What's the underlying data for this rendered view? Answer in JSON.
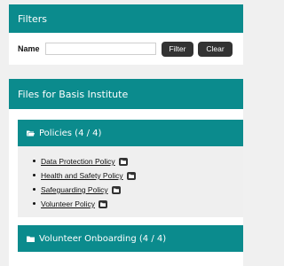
{
  "filters": {
    "title": "Filters",
    "name_label": "Name",
    "name_value": "",
    "filter_button": "Filter",
    "clear_button": "Clear"
  },
  "files": {
    "title": "Files for Basis Institute",
    "sections": [
      {
        "title": "Policies (4 / 4)",
        "icon": "folder-open-icon",
        "items": [
          {
            "label": "Data Protection Policy",
            "icon": "file-icon"
          },
          {
            "label": "Health and Safety Policy",
            "icon": "file-icon"
          },
          {
            "label": "Safeguarding Policy",
            "icon": "file-icon"
          },
          {
            "label": "Volunteer Policy",
            "icon": "file-icon"
          }
        ]
      },
      {
        "title": "Volunteer Onboarding (4 / 4)",
        "icon": "folder-icon"
      }
    ]
  },
  "colors": {
    "accent": "#0b8b8d",
    "button": "#333333",
    "background": "#f0f0f0"
  }
}
